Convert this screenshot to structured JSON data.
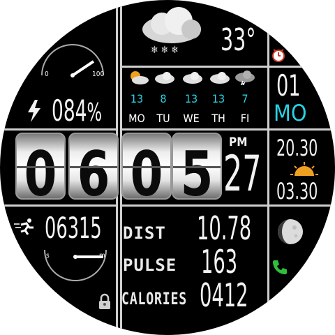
{
  "battery": {
    "gauge_min": "0",
    "gauge_max": "100",
    "percent_text": "084",
    "percent_sign": "%"
  },
  "steps": {
    "count": "06315",
    "gauge_start": "s",
    "gauge_end": "m"
  },
  "time": {
    "hour_1": "0",
    "hour_2": "6",
    "minute_1": "0",
    "minute_2": "5",
    "meridiem": "PM",
    "day_number": "27"
  },
  "weather": {
    "current_temp": "33°",
    "forecast": [
      {
        "day": "MO",
        "temp": "13",
        "icon": "partly-cloudy-sun-icon"
      },
      {
        "day": "TU",
        "temp": "8",
        "icon": "cloud-icon"
      },
      {
        "day": "WE",
        "temp": "13",
        "icon": "cloud-icon"
      },
      {
        "day": "TH",
        "temp": "13",
        "icon": "cloud-icon"
      },
      {
        "day": "FI",
        "temp": "7",
        "icon": "storm-cloud-icon"
      }
    ]
  },
  "date": {
    "month_number": "01",
    "weekday_abbr": "MO"
  },
  "sun": {
    "sunset": "20.30",
    "sunrise": "03.30"
  },
  "stats": {
    "distance_label": "DIST",
    "distance_value": "10.78",
    "pulse_label": "PULSE",
    "pulse_value": "163",
    "calories_label": "CALORIES",
    "calories_value": "0412"
  },
  "colors": {
    "accent_cyan": "#28d3e4",
    "alarm_red": "#d23a2a",
    "phone_green": "#2fbf3c",
    "sun_orange": "#f0a020"
  }
}
